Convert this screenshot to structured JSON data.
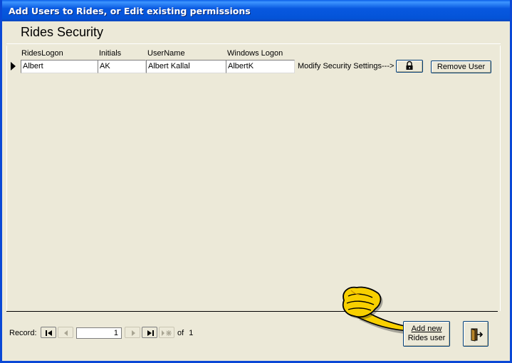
{
  "window": {
    "title": "Add Users to Rides, or Edit existing permissions"
  },
  "page": {
    "title": "Rides Security"
  },
  "columns": [
    "RidesLogon",
    "Initials",
    "UserName",
    "Windows Logon"
  ],
  "rows": [
    {
      "rides_logon": "Albert",
      "initials": "AK",
      "user_name": "Albert Kallal",
      "windows_logon": "AlbertK"
    }
  ],
  "row_actions": {
    "modify_label": "Modify Security Settings--->",
    "lock_icon": "lock-icon",
    "remove_label": "Remove User"
  },
  "footer": {
    "add_button_line1": "Add new",
    "add_button_line2": "Rides user",
    "exit_icon": "exit-door-icon",
    "pointer_icon": "pointing-hand-icon"
  },
  "navigator": {
    "record_label": "Record:",
    "current_record": "1",
    "of_label": "of",
    "total_records": "1"
  },
  "colors": {
    "titlebar": "#0454d8",
    "window_bg": "#ece9d8",
    "hand_fill": "#f8d000"
  }
}
